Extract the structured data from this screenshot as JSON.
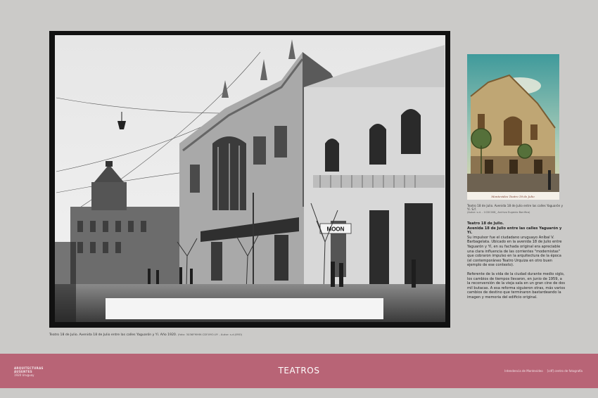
{
  "caption_main": "Teatro 18 de Julio. Avenida 18 de Julio entre las calles Yaguarón y Yí. Año 1920.",
  "caption_main_source": "(foto: 3036FMHM.CDF.IMO.UY - Autor: s.d./IMO)",
  "card_caption": "Teatro 18 de Julio. Avenida 18 de Julio entre las calles Yaguarón y Yí. S.f.",
  "card_caption_source": "(Autor: s.d. - 1CDC008_ Archivo Eugenio Bonifica)",
  "card_script": "Montevideo Teatro 18 de Julio",
  "sign_text": "MOON",
  "text": {
    "heading1": "Teatro 18 de Julio.",
    "heading2": "Avenida 18 de Julio entre las calles Yaguarón y Yí.",
    "para1": "Su impulsor fue el ciudadano uruguayo Aníbal V. Barbagelata. Ubicado en la avenida 18 de Julio entre Yaguarón y Yí, en su fachada original era apreciable una clara influencia de las corrientes \"modernistas\" que cobraron impulso en la arquitectura de la época (el contemporáneo Teatro Urquiza en otro buen ejemplo de ese contexto).",
    "para2": "Referente de la vida de la ciudad durante medio siglo, los cambios de tiempos llevaron, en junio de 1959, a la reconversión de la vieja sala en un gran cine de dos mil butacas. A esa reforma siguieron otras, más varios cambios de destino que terminaron bastardeando la imagen y memoria del edificio original."
  },
  "band": {
    "title": "TEATROS",
    "left_line1": "ARQUITECTURAS",
    "left_line2": "AUSENTES",
    "left_line3": "1920 Uruguay",
    "right_logo1": "Intendencia de Montevideo",
    "right_logo2": "[cdf] centro de fotografía"
  },
  "colors": {
    "band": "#b86476",
    "background": "#cbcac8"
  }
}
